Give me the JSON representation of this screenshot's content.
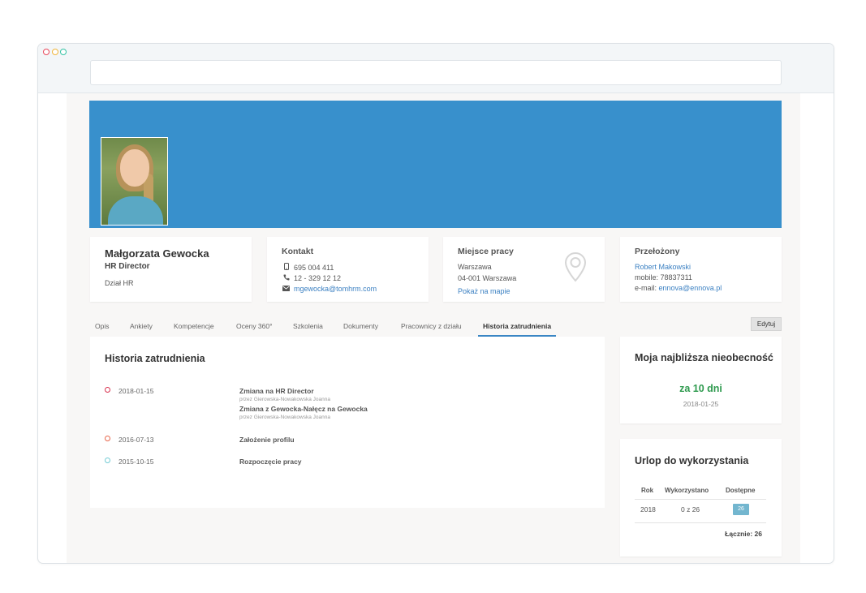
{
  "browser": {
    "url": ""
  },
  "profile": {
    "name": "Małgorzata Gewocka",
    "role": "HR Director",
    "department": "Dział HR"
  },
  "contact": {
    "title": "Kontakt",
    "mobile": "695 004 411",
    "phone": "12 - 329 12 12",
    "email": "mgewocka@tomhrm.com"
  },
  "workplace": {
    "title": "Miejsce pracy",
    "city": "Warszawa",
    "postal": "04-001 Warszawa",
    "map_link": "Pokaż na mapie"
  },
  "supervisor": {
    "title": "Przełożony",
    "name": "Robert Makowski",
    "mobile_label": "mobile:",
    "mobile": "78837311",
    "email_label": "e-mail:",
    "email": "ennova@ennova.pl"
  },
  "tabs": [
    {
      "label": "Opis"
    },
    {
      "label": "Ankiety"
    },
    {
      "label": "Kompetencje"
    },
    {
      "label": "Oceny 360°"
    },
    {
      "label": "Szkolenia"
    },
    {
      "label": "Dokumenty"
    },
    {
      "label": "Pracownicy z działu"
    },
    {
      "label": "Historia zatrudnienia",
      "active": true
    }
  ],
  "edit_label": "Edytuj",
  "history": {
    "title": "Historia zatrudnienia",
    "entries": [
      {
        "date": "2018-01-15",
        "dot_color": "#d8324f",
        "events": [
          {
            "text": "Zmiana na HR Director",
            "by": "przez Gierowska-Nowakowska Joanna"
          },
          {
            "text": "Zmiana z Gewocka-Nałęcz na Gewocka",
            "by": "przez Gierowska-Nowakowska Joanna"
          }
        ]
      },
      {
        "date": "2016-07-13",
        "dot_color": "#e8664a",
        "events": [
          {
            "text": "Założenie profilu"
          }
        ]
      },
      {
        "date": "2015-10-15",
        "dot_color": "#72cbd4",
        "events": [
          {
            "text": "Rozpoczęcie pracy"
          }
        ]
      }
    ]
  },
  "absence": {
    "title": "Moja najbliższa nieobecność",
    "days": "za 10 dni",
    "date": "2018-01-25"
  },
  "leave": {
    "title": "Urlop do wykorzystania",
    "headers": [
      "Rok",
      "Wykorzystano",
      "Dostępne"
    ],
    "rows": [
      {
        "year": "2018",
        "used": "0 z 26",
        "available": "26"
      }
    ],
    "total": "Łącznie: 26"
  },
  "colors": {
    "banner": "#3890cc",
    "accent": "#3a86c4",
    "positive": "#2e9a4e",
    "badge": "#73b6cf"
  },
  "icons": {
    "mobile": "mobile-icon",
    "phone": "phone-icon",
    "email": "envelope-icon",
    "map": "map-pin-icon"
  }
}
